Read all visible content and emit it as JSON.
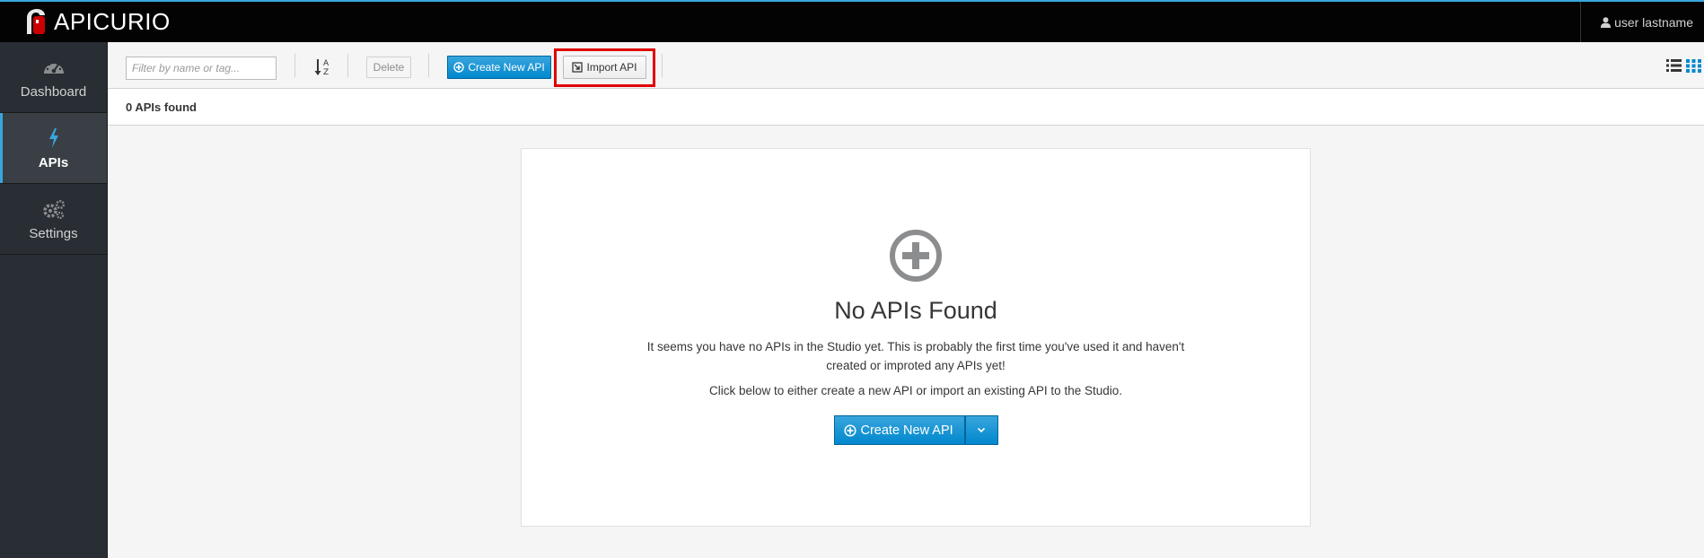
{
  "header": {
    "brand_name": "APICURIO",
    "user_label": "user lastname"
  },
  "sidebar": {
    "items": [
      {
        "label": "Dashboard",
        "icon": "dashboard-icon",
        "active": false
      },
      {
        "label": "APIs",
        "icon": "bolt-icon",
        "active": true
      },
      {
        "label": "Settings",
        "icon": "gears-icon",
        "active": false
      }
    ]
  },
  "toolbar": {
    "filter_placeholder": "Filter by name or tag...",
    "filter_value": "",
    "delete_label": "Delete",
    "create_label": "Create New API",
    "import_label": "Import API"
  },
  "results": {
    "count_text": "0 APIs found"
  },
  "empty_state": {
    "title": "No APIs Found",
    "message": "It seems you have no APIs in the Studio yet. This is probably the first time you've used it and haven't created or improted any APIs yet!",
    "hint": "Click below to either create a new API or import an existing API to the Studio.",
    "button_label": "Create New API"
  },
  "colors": {
    "accent": "#0088ce",
    "highlight": "#e00000",
    "topbar": "#030303",
    "sidebar": "#292e34"
  }
}
